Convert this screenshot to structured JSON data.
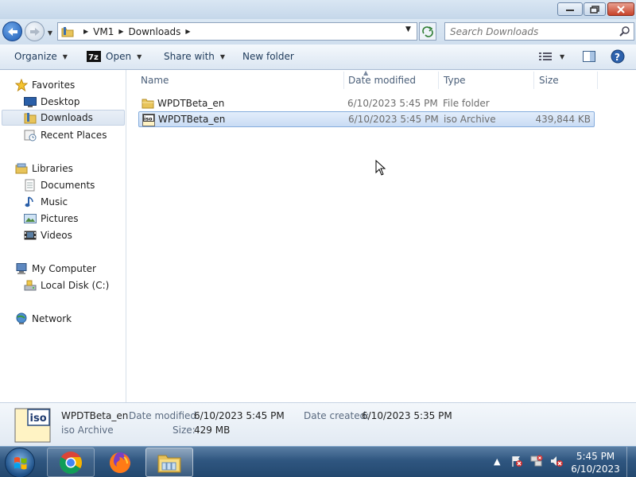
{
  "window": {
    "buttons": {
      "minimize": "minimize",
      "maximize": "maximize",
      "close": "close"
    }
  },
  "address": {
    "breadcrumbs": [
      "VM1",
      "Downloads"
    ],
    "search_placeholder": "Search Downloads"
  },
  "toolbar": {
    "organize": "Organize",
    "open": "Open",
    "share_with": "Share with",
    "new_folder": "New folder"
  },
  "nav": {
    "favorites": "Favorites",
    "desktop": "Desktop",
    "downloads": "Downloads",
    "recent_places": "Recent Places",
    "libraries": "Libraries",
    "documents": "Documents",
    "music": "Music",
    "pictures": "Pictures",
    "videos": "Videos",
    "my_computer": "My Computer",
    "local_disk": "Local Disk (C:)",
    "network": "Network"
  },
  "columns": {
    "name": "Name",
    "date_modified": "Date modified",
    "type": "Type",
    "size": "Size"
  },
  "files": [
    {
      "name": "WPDTBeta_en",
      "date": "6/10/2023 5:45 PM",
      "type": "File folder",
      "size": "",
      "icon": "folder-icon"
    },
    {
      "name": "WPDTBeta_en",
      "date": "6/10/2023 5:45 PM",
      "type": "iso Archive",
      "size": "439,844 KB",
      "icon": "iso-file-icon"
    }
  ],
  "details": {
    "name": "WPDTBeta_en",
    "type": "iso Archive",
    "date_modified_label": "Date modified:",
    "date_modified": "6/10/2023 5:45 PM",
    "date_created_label": "Date created:",
    "date_created": "6/10/2023 5:35 PM",
    "size_label": "Size:",
    "size": "429 MB"
  },
  "taskbar": {
    "time": "5:45 PM",
    "date": "6/10/2023"
  },
  "colors": {
    "selection_bg": "#c9dcf4",
    "selection_border": "#84acdd",
    "taskbar": "#2f5680"
  }
}
